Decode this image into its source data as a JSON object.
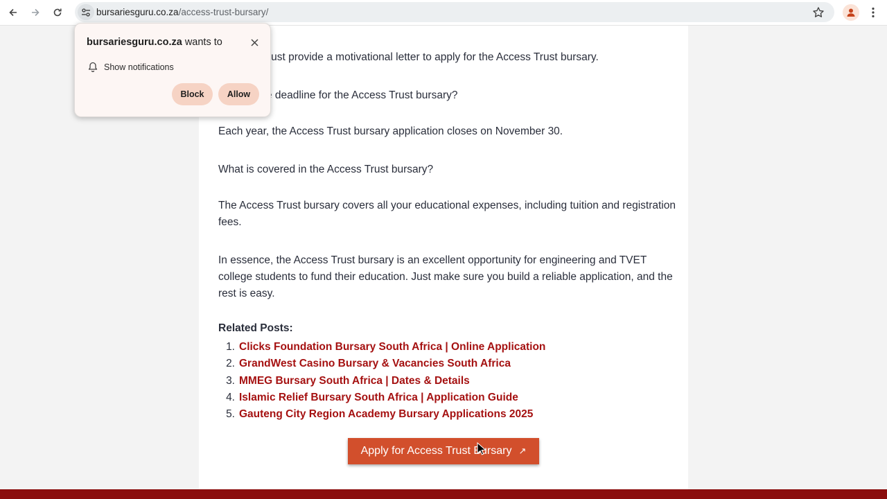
{
  "browser": {
    "url_host": "bursariesguru.co.za",
    "url_path": "/access-trust-bursary/"
  },
  "popup": {
    "site": "bursariesguru.co.za",
    "wants_to": " wants to",
    "permission": "Show notifications",
    "block_label": "Block",
    "allow_label": "Allow"
  },
  "article": {
    "p1": "Yes, you must provide a motivational letter to apply for the Access Trust bursary.",
    "q2": "What is the deadline for the Access Trust bursary?",
    "p2": "Each year, the Access Trust bursary application closes on November 30.",
    "q3": "What is covered in the Access Trust bursary?",
    "p3": "The Access Trust bursary covers all your educational expenses, including tuition and registration fees.",
    "p4": "In essence, the Access Trust bursary is an excellent opportunity for engineering and TVET college students to fund their education. Just make sure you build a reliable application, and the rest is easy.",
    "related_title": "Related Posts:",
    "related": [
      {
        "num": "1.",
        "title": "Clicks Foundation Bursary South Africa | Online Application"
      },
      {
        "num": "2.",
        "title": "GrandWest Casino Bursary & Vacancies South Africa"
      },
      {
        "num": "3.",
        "title": "MMEG Bursary South Africa | Dates & Details"
      },
      {
        "num": "4.",
        "title": "Islamic Relief Bursary South Africa | Application Guide"
      },
      {
        "num": "5.",
        "title": "Gauteng City Region Academy Bursary Applications 2025"
      }
    ],
    "apply_label": "Apply for Access Trust Bursary",
    "apply_arrow": "↗"
  },
  "colors": {
    "link": "#a51111",
    "apply_button": "#d24f2c",
    "footer": "#8b0d0d"
  }
}
